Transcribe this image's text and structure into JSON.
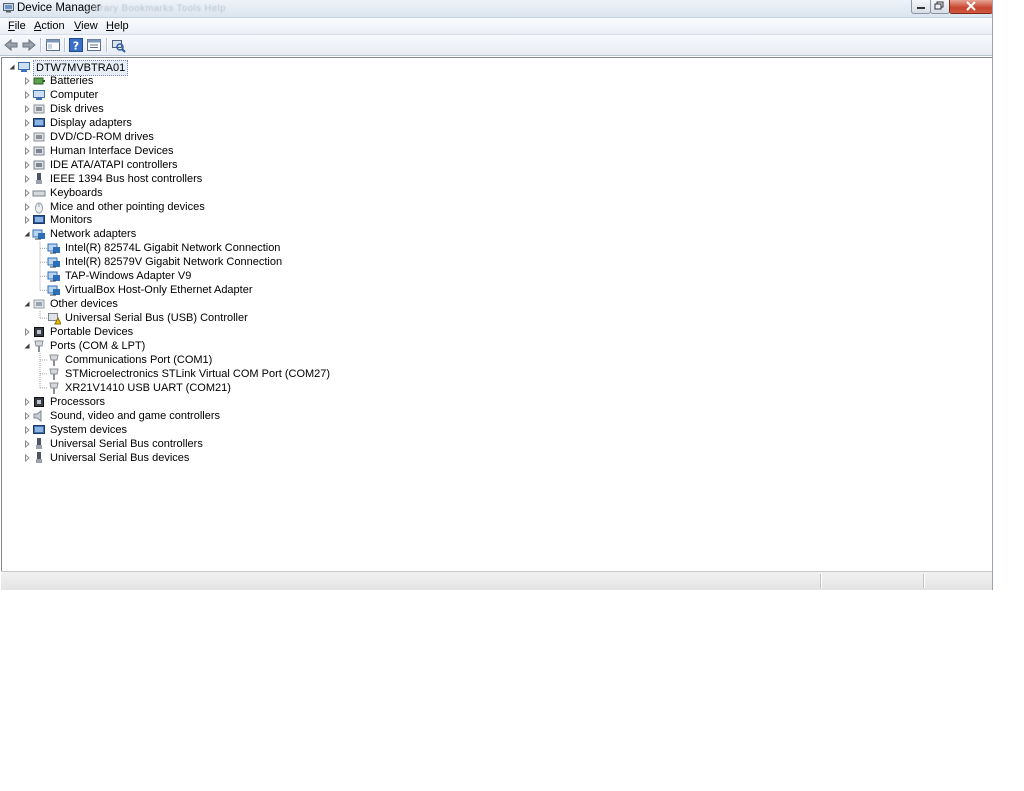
{
  "window": {
    "title": "Device Manager",
    "blurred_menu_text": "Library   Bookmarks   Tools   Help"
  },
  "menu": {
    "items": [
      {
        "accel": "F",
        "rest": "ile"
      },
      {
        "accel": "A",
        "rest": "ction"
      },
      {
        "accel": "V",
        "rest": "iew"
      },
      {
        "accel": "H",
        "rest": "elp"
      }
    ]
  },
  "toolbar": {
    "icons": [
      "back-arrow-icon",
      "forward-arrow-icon",
      "show-hide-console-tree-icon",
      "help-icon",
      "properties-icon",
      "scan-hardware-icon"
    ]
  },
  "tree": {
    "root": "DTW7MVBTRA01",
    "nodes": [
      {
        "label": "Batteries",
        "expanded": false,
        "icon": "battery-icon"
      },
      {
        "label": "Computer",
        "expanded": false,
        "icon": "computer-icon"
      },
      {
        "label": "Disk drives",
        "expanded": false,
        "icon": "disk-drive-icon"
      },
      {
        "label": "Display adapters",
        "expanded": false,
        "icon": "display-adapter-icon"
      },
      {
        "label": "DVD/CD-ROM drives",
        "expanded": false,
        "icon": "dvd-drive-icon"
      },
      {
        "label": "Human Interface Devices",
        "expanded": false,
        "icon": "hid-icon"
      },
      {
        "label": "IDE ATA/ATAPI controllers",
        "expanded": false,
        "icon": "ide-controller-icon"
      },
      {
        "label": "IEEE 1394 Bus host controllers",
        "expanded": false,
        "icon": "ieee1394-icon"
      },
      {
        "label": "Keyboards",
        "expanded": false,
        "icon": "keyboard-icon"
      },
      {
        "label": "Mice and other pointing devices",
        "expanded": false,
        "icon": "mouse-icon"
      },
      {
        "label": "Monitors",
        "expanded": false,
        "icon": "monitor-icon"
      },
      {
        "label": "Network adapters",
        "expanded": true,
        "icon": "network-adapter-icon",
        "children": [
          {
            "label": "Intel(R) 82574L Gigabit Network Connection",
            "icon": "network-adapter-icon"
          },
          {
            "label": "Intel(R) 82579V Gigabit Network Connection",
            "icon": "network-adapter-icon"
          },
          {
            "label": "TAP-Windows Adapter V9",
            "icon": "network-adapter-icon"
          },
          {
            "label": "VirtualBox Host-Only Ethernet Adapter",
            "icon": "network-adapter-icon"
          }
        ]
      },
      {
        "label": "Other devices",
        "expanded": true,
        "icon": "unknown-device-icon",
        "children": [
          {
            "label": "Universal Serial Bus (USB) Controller",
            "icon": "warning-device-icon"
          }
        ]
      },
      {
        "label": "Portable Devices",
        "expanded": false,
        "icon": "portable-device-icon"
      },
      {
        "label": "Ports (COM & LPT)",
        "expanded": true,
        "icon": "port-icon",
        "children": [
          {
            "label": "Communications Port (COM1)",
            "icon": "port-icon"
          },
          {
            "label": "STMicroelectronics STLink Virtual COM Port (COM27)",
            "icon": "port-icon"
          },
          {
            "label": "XR21V1410 USB UART (COM21)",
            "icon": "port-icon"
          }
        ]
      },
      {
        "label": "Processors",
        "expanded": false,
        "icon": "processor-icon"
      },
      {
        "label": "Sound, video and game controllers",
        "expanded": false,
        "icon": "sound-icon"
      },
      {
        "label": "System devices",
        "expanded": false,
        "icon": "system-device-icon"
      },
      {
        "label": "Universal Serial Bus controllers",
        "expanded": false,
        "icon": "usb-icon"
      },
      {
        "label": "Universal Serial Bus devices",
        "expanded": false,
        "icon": "usb-icon"
      }
    ]
  },
  "colors": {
    "titlebar": "#dbe4ef",
    "close_button": "#c7452f",
    "root_selection": "#e8eef7"
  }
}
